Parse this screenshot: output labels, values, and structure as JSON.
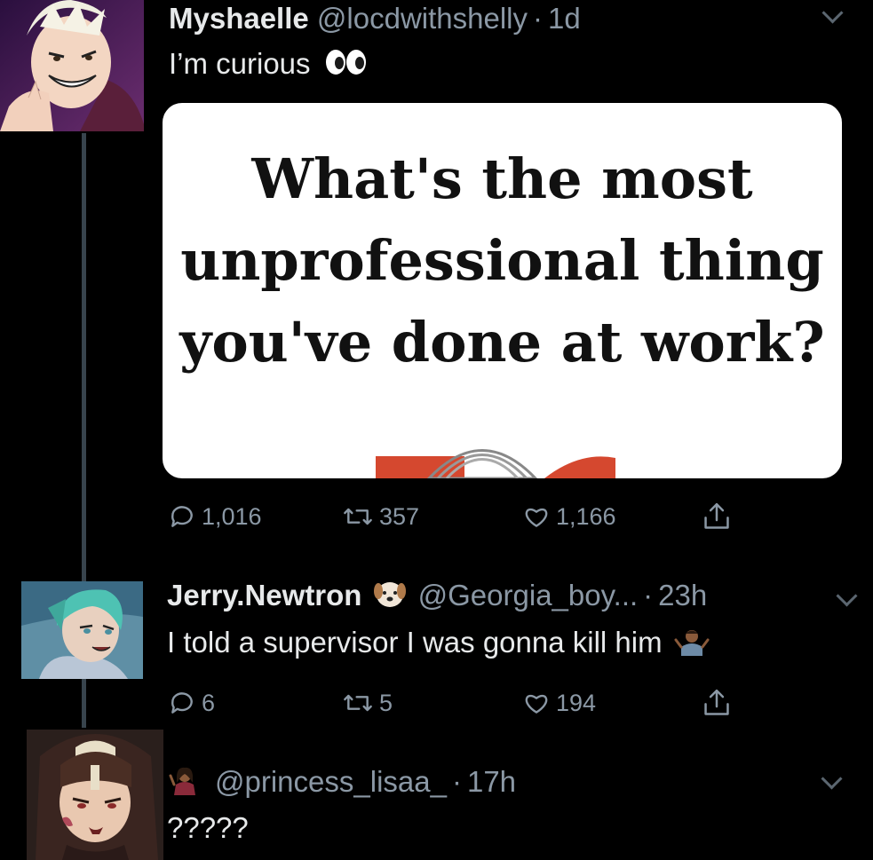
{
  "tweets": [
    {
      "display_name": "Myshaelle",
      "handle": "@locdwithshelly",
      "separator": "·",
      "time": "1d",
      "text": "I’m curious",
      "emoji": "eyes-emoji",
      "media_text": "What's the most unprofessional thing you've done at work?",
      "replies": "1,016",
      "retweets": "357",
      "likes": "1,166"
    },
    {
      "display_name": "Jerry.Newtron",
      "handle": "@Georgia_boy...",
      "separator": "·",
      "time": "23h",
      "text": "I told a supervisor I was gonna kill him",
      "emoji": "person-shrugging-emoji",
      "name_emoji": "dog-face-emoji",
      "replies": "6",
      "retweets": "5",
      "likes": "194"
    },
    {
      "display_name": "",
      "handle": "@princess_lisaa_",
      "separator": "·",
      "time": "17h",
      "text": "?????",
      "name_emoji": "woman-tipping-hand-emoji"
    }
  ],
  "icons": {
    "reply": "reply-icon",
    "retweet": "retweet-icon",
    "like": "heart-icon",
    "share": "share-icon",
    "more": "chevron-down-icon"
  },
  "colors": {
    "background": "#000000",
    "text": "#e7e9ea",
    "secondary": "#8b98a5",
    "thread_line": "#38444d"
  }
}
